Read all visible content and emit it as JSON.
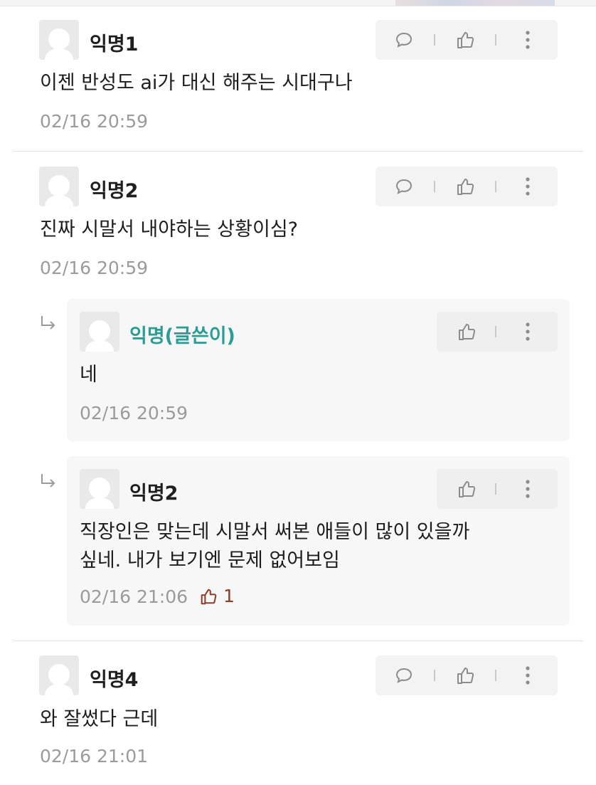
{
  "comments": [
    {
      "author": "익명1",
      "text": "이젠 반성도 ai가 대신 해주는 시대구나",
      "date": "02/16 20:59"
    },
    {
      "author": "익명2",
      "text": "진짜 시말서 내야하는 상황이심?",
      "date": "02/16 20:59",
      "replies": [
        {
          "author": "익명(글쓴이)",
          "text": "네",
          "date": "02/16 20:59"
        },
        {
          "author": "익명2",
          "text_line1": "직장인은 맞는데 시말서 써본 애들이 많이 있을까",
          "text_line2": "싶네. 내가 보기엔 문제 없어보임",
          "date": "02/16 21:06",
          "like_count": "1"
        }
      ]
    },
    {
      "author": "익명4",
      "text": "와 잘썼다 근데",
      "date": "02/16 21:01"
    }
  ],
  "icons": {
    "comment": "speech-bubble-icon",
    "like": "thumbs-up-icon",
    "more": "kebab-menu-icon",
    "reply": "reply-arrow-icon"
  },
  "colors": {
    "writer_name": "#2a9d94",
    "like_count": "#8d3d2a",
    "date": "#9b9b9b"
  }
}
